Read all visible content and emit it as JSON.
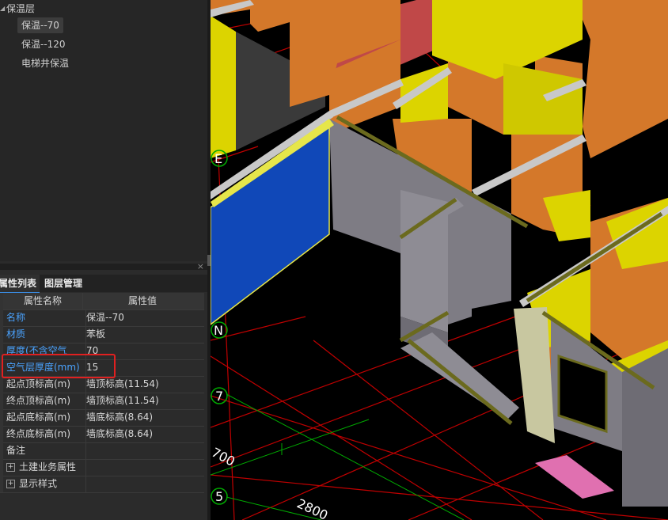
{
  "tree": {
    "root_label": "保温层",
    "items": [
      {
        "label": "保温--70",
        "selected": true
      },
      {
        "label": "保温--120",
        "selected": false
      },
      {
        "label": "电梯井保温",
        "selected": false
      }
    ]
  },
  "panel": {
    "close_glyph": "×",
    "tabs": [
      {
        "label": "属性列表",
        "active": true
      },
      {
        "label": "图层管理",
        "active": false
      }
    ],
    "columns": {
      "name": "属性名称",
      "value": "属性值"
    },
    "rows": [
      {
        "name": "名称",
        "value": "保温--70",
        "blue": true
      },
      {
        "name": "材质",
        "value": "苯板",
        "blue": true
      },
      {
        "name": "厚度(不含空气",
        "value": "70",
        "blue": true
      },
      {
        "name": "空气层厚度(mm)",
        "value": "15",
        "blue": true
      },
      {
        "name": "起点顶标高(m)",
        "value": "墙顶标高(11.54)",
        "blue": false
      },
      {
        "name": "终点顶标高(m)",
        "value": "墙顶标高(11.54)",
        "blue": false
      },
      {
        "name": "起点底标高(m)",
        "value": "墙底标高(8.64)",
        "blue": false
      },
      {
        "name": "终点底标高(m)",
        "value": "墙底标高(8.64)",
        "blue": false
      },
      {
        "name": "备注",
        "value": "",
        "blue": false
      },
      {
        "name": "土建业务属性",
        "value": "",
        "blue": false,
        "expandable": true
      },
      {
        "name": "显示样式",
        "value": "",
        "blue": false,
        "expandable": true
      }
    ]
  },
  "viewport": {
    "axis_labels": [
      "E",
      "N",
      "7",
      "5"
    ],
    "dimensions": [
      "700",
      "2800"
    ],
    "colors": {
      "wall_orange": "#d4782a",
      "wall_yellow": "#dcd400",
      "wall_gray": "#8a8890",
      "insulation_blue": "#1048b8",
      "grid_red": "#cc0000",
      "grid_green": "#00aa00"
    }
  }
}
